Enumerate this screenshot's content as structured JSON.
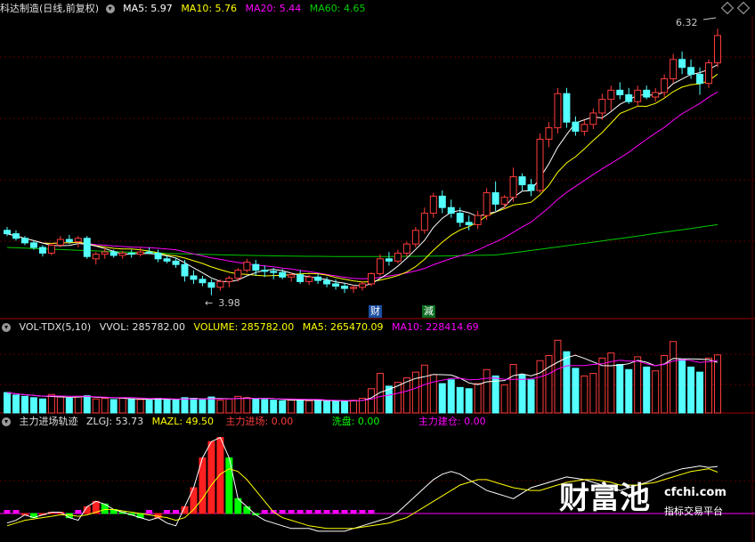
{
  "header": {
    "title": "科达制造(日线,前复权)",
    "ma5": "MA5: 5.97",
    "ma10": "MA10: 5.76",
    "ma20": "MA20: 5.44",
    "ma60": "MA60: 4.65"
  },
  "price_labels": {
    "high": "6.32",
    "low": "3.98"
  },
  "markers": {
    "cai": "财",
    "jian": "減"
  },
  "vol_header": {
    "name": "VOL-TDX(5,10)",
    "vvol": "VVOL: 285782.00",
    "volume": "VOLUME: 285782.00",
    "ma5": "MA5: 265470.09",
    "ma10": "MA10: 228414.69"
  },
  "ind_header": {
    "name": "主力进场轨迹",
    "zlgj": "ZLGJ: 53.73",
    "mazl": "MAZL: 49.50",
    "zljc": "主力进场: 0.00",
    "xp": "洗盘: 0.00",
    "zljc2": "主力建仓: 0.00"
  },
  "watermark": {
    "brand": "财富池",
    "url": "cfchi.com",
    "slogan": "指标交易平台"
  },
  "colors": {
    "up": "#ff3c3c",
    "down": "#54ffff",
    "ma5": "#ffffff",
    "ma10": "#ffff00",
    "ma20": "#ff00ff",
    "ma60": "#00c800"
  },
  "chart_data": {
    "type": "candlestick",
    "candles": [
      [
        4.55,
        4.58,
        4.5,
        4.52
      ],
      [
        4.52,
        4.55,
        4.46,
        4.48
      ],
      [
        4.48,
        4.5,
        4.42,
        4.44
      ],
      [
        4.44,
        4.46,
        4.38,
        4.4
      ],
      [
        4.4,
        4.42,
        4.32,
        4.35
      ],
      [
        4.35,
        4.44,
        4.33,
        4.42
      ],
      [
        4.42,
        4.5,
        4.4,
        4.47
      ],
      [
        4.47,
        4.51,
        4.43,
        4.45
      ],
      [
        4.45,
        4.5,
        4.4,
        4.48
      ],
      [
        4.48,
        4.5,
        4.3,
        4.32
      ],
      [
        4.3,
        4.36,
        4.25,
        4.34
      ],
      [
        4.34,
        4.4,
        4.3,
        4.36
      ],
      [
        4.36,
        4.38,
        4.31,
        4.33
      ],
      [
        4.33,
        4.37,
        4.3,
        4.35
      ],
      [
        4.35,
        4.38,
        4.31,
        4.34
      ],
      [
        4.34,
        4.4,
        4.32,
        4.36
      ],
      [
        4.36,
        4.4,
        4.34,
        4.35
      ],
      [
        4.35,
        4.38,
        4.27,
        4.3
      ],
      [
        4.3,
        4.33,
        4.26,
        4.28
      ],
      [
        4.28,
        4.31,
        4.22,
        4.25
      ],
      [
        4.25,
        4.29,
        4.1,
        4.15
      ],
      [
        4.15,
        4.2,
        4.08,
        4.12
      ],
      [
        4.12,
        4.15,
        4.06,
        4.09
      ],
      [
        4.09,
        4.12,
        3.98,
        4.05
      ],
      [
        4.05,
        4.12,
        4.02,
        4.1
      ],
      [
        4.1,
        4.15,
        4.05,
        4.13
      ],
      [
        4.13,
        4.22,
        4.1,
        4.2
      ],
      [
        4.2,
        4.3,
        4.18,
        4.27
      ],
      [
        4.25,
        4.29,
        4.15,
        4.2
      ],
      [
        4.2,
        4.24,
        4.14,
        4.19
      ],
      [
        4.19,
        4.22,
        4.12,
        4.18
      ],
      [
        4.18,
        4.21,
        4.12,
        4.14
      ],
      [
        4.14,
        4.18,
        4.1,
        4.16
      ],
      [
        4.16,
        4.2,
        4.08,
        4.1
      ],
      [
        4.1,
        4.16,
        4.07,
        4.14
      ],
      [
        4.14,
        4.17,
        4.08,
        4.11
      ],
      [
        4.11,
        4.14,
        4.05,
        4.08
      ],
      [
        4.08,
        4.12,
        4.03,
        4.06
      ],
      [
        4.06,
        4.09,
        4.0,
        4.04
      ],
      [
        4.04,
        4.07,
        4.0,
        4.05
      ],
      [
        4.05,
        4.1,
        4.02,
        4.08
      ],
      [
        4.08,
        4.18,
        4.06,
        4.17
      ],
      [
        4.17,
        4.34,
        4.15,
        4.3
      ],
      [
        4.3,
        4.36,
        4.24,
        4.28
      ],
      [
        4.28,
        4.38,
        4.26,
        4.35
      ],
      [
        4.35,
        4.45,
        4.32,
        4.43
      ],
      [
        4.43,
        4.58,
        4.4,
        4.55
      ],
      [
        4.55,
        4.75,
        4.52,
        4.7
      ],
      [
        4.7,
        4.88,
        4.66,
        4.85
      ],
      [
        4.85,
        4.9,
        4.7,
        4.75
      ],
      [
        4.75,
        4.82,
        4.66,
        4.7
      ],
      [
        4.7,
        4.75,
        4.58,
        4.62
      ],
      [
        4.62,
        4.68,
        4.55,
        4.6
      ],
      [
        4.6,
        4.72,
        4.56,
        4.68
      ],
      [
        4.68,
        4.92,
        4.64,
        4.88
      ],
      [
        4.88,
        4.98,
        4.72,
        4.78
      ],
      [
        4.78,
        4.86,
        4.74,
        4.84
      ],
      [
        4.84,
        5.1,
        4.8,
        5.02
      ],
      [
        5.02,
        5.05,
        4.9,
        4.95
      ],
      [
        4.95,
        5.0,
        4.85,
        4.9
      ],
      [
        4.9,
        5.4,
        4.88,
        5.35
      ],
      [
        5.35,
        5.5,
        5.28,
        5.45
      ],
      [
        5.45,
        5.8,
        5.4,
        5.75
      ],
      [
        5.75,
        5.8,
        5.45,
        5.5
      ],
      [
        5.5,
        5.55,
        5.38,
        5.42
      ],
      [
        5.42,
        5.52,
        5.38,
        5.48
      ],
      [
        5.48,
        5.62,
        5.44,
        5.58
      ],
      [
        5.58,
        5.75,
        5.52,
        5.7
      ],
      [
        5.7,
        5.82,
        5.6,
        5.78
      ],
      [
        5.78,
        5.85,
        5.7,
        5.74
      ],
      [
        5.74,
        5.8,
        5.66,
        5.68
      ],
      [
        5.68,
        5.82,
        5.64,
        5.78
      ],
      [
        5.78,
        5.82,
        5.7,
        5.72
      ],
      [
        5.72,
        5.8,
        5.68,
        5.76
      ],
      [
        5.76,
        5.92,
        5.72,
        5.88
      ],
      [
        5.88,
        6.1,
        5.84,
        6.05
      ],
      [
        6.05,
        6.12,
        5.92,
        5.98
      ],
      [
        5.98,
        6.05,
        5.88,
        5.92
      ],
      [
        5.92,
        5.98,
        5.74,
        5.84
      ],
      [
        5.84,
        6.05,
        5.8,
        6.02
      ],
      [
        6.02,
        6.32,
        5.98,
        6.26
      ]
    ],
    "volume": [
      3.2,
      2.8,
      2.6,
      2.4,
      2.2,
      2.9,
      2.5,
      2.3,
      2.6,
      2.7,
      2.2,
      2.3,
      2.1,
      2.3,
      2.2,
      2.1,
      2.0,
      2.3,
      2.2,
      2.1,
      2.4,
      2.3,
      2.1,
      2.5,
      2.0,
      2.2,
      2.6,
      2.4,
      2.2,
      2.1,
      2.0,
      1.9,
      2.0,
      2.1,
      1.9,
      2.0,
      1.8,
      1.9,
      1.8,
      2.0,
      2.3,
      3.8,
      6.2,
      4.2,
      4.8,
      5.5,
      6.4,
      7.5,
      6.0,
      4.6,
      5.2,
      4.0,
      3.8,
      4.6,
      6.8,
      5.8,
      4.4,
      7.6,
      6.0,
      5.2,
      8.2,
      9.0,
      11.4,
      9.6,
      7.0,
      5.8,
      6.2,
      8.6,
      9.4,
      7.6,
      6.8,
      8.8,
      7.2,
      6.6,
      9.0,
      11.2,
      8.4,
      7.2,
      6.4,
      8.6,
      9.1
    ],
    "zlgj": [
      12,
      14,
      18,
      16,
      18,
      20,
      20,
      16,
      14,
      24,
      28,
      26,
      22,
      20,
      18,
      16,
      14,
      16,
      12,
      10,
      24,
      38,
      60,
      72,
      75,
      60,
      30,
      24,
      18,
      14,
      12,
      10,
      8,
      8,
      8,
      6,
      6,
      6,
      6,
      8,
      10,
      12,
      14,
      16,
      20,
      26,
      32,
      38,
      44,
      48,
      50,
      48,
      44,
      40,
      36,
      34,
      32,
      30,
      34,
      38,
      40,
      42,
      44,
      46,
      45,
      44,
      42,
      40,
      38,
      36,
      38,
      40,
      42,
      45,
      48,
      50,
      52,
      53,
      54,
      53,
      53.73
    ],
    "mazl": [
      10,
      12,
      14,
      15,
      16,
      17,
      18,
      18,
      17,
      18,
      20,
      22,
      22,
      21,
      20,
      19,
      18,
      17,
      16,
      14,
      16,
      22,
      30,
      40,
      48,
      52,
      50,
      44,
      36,
      28,
      20,
      16,
      14,
      12,
      10,
      9,
      8,
      8,
      8,
      8,
      9,
      10,
      11,
      12,
      14,
      16,
      20,
      24,
      28,
      32,
      36,
      40,
      42,
      44,
      44,
      42,
      40,
      38,
      37,
      36,
      36,
      38,
      40,
      42,
      43,
      44,
      44,
      43,
      42,
      40,
      40,
      40,
      41,
      42,
      44,
      46,
      48,
      50,
      51,
      52,
      49.5
    ]
  }
}
